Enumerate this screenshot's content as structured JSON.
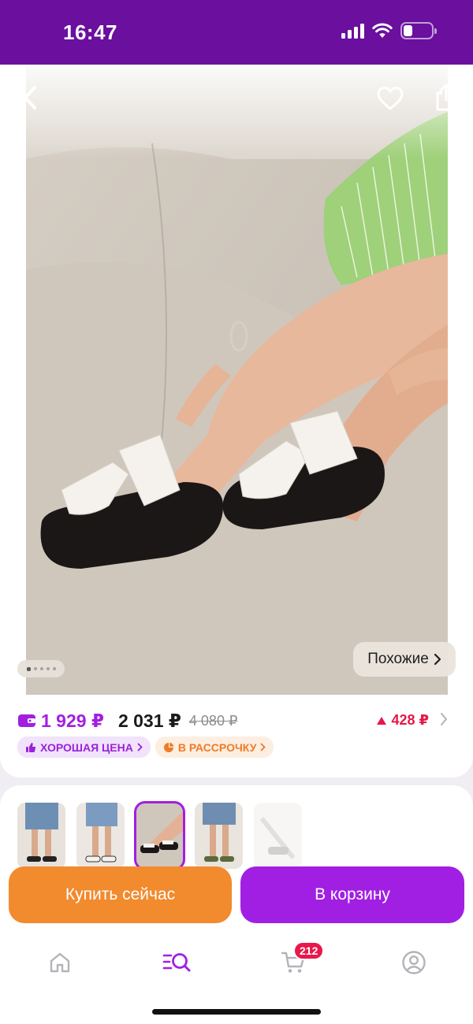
{
  "status_bar": {
    "time": "16:47",
    "battery_level_percent": 30
  },
  "product": {
    "gallery": {
      "total_photos": 5,
      "current_photo": 1
    },
    "similar_label": "Похожие",
    "price": {
      "card_price": "1 929 ₽",
      "price": "2 031 ₽",
      "old_price": "4 080 ₽",
      "change": "428 ₽",
      "change_color": "#e5184a"
    },
    "badges": {
      "good_price": "ХОРОШАЯ ЦЕНА",
      "installment": "В РАССРОЧКУ"
    }
  },
  "actions": {
    "buy_now": "Купить сейчас",
    "add_to_cart": "В корзину"
  },
  "tab_bar": {
    "items": [
      {
        "name": "home",
        "icon": "home-icon"
      },
      {
        "name": "catalog",
        "icon": "catalog-search-icon",
        "active": true
      },
      {
        "name": "cart",
        "icon": "cart-icon"
      },
      {
        "name": "profile",
        "icon": "profile-icon"
      }
    ],
    "cart_count": "212"
  },
  "colors": {
    "brand": "#6a0f9e",
    "accent_purple": "#a11fe3",
    "accent_orange": "#f28a2e"
  }
}
